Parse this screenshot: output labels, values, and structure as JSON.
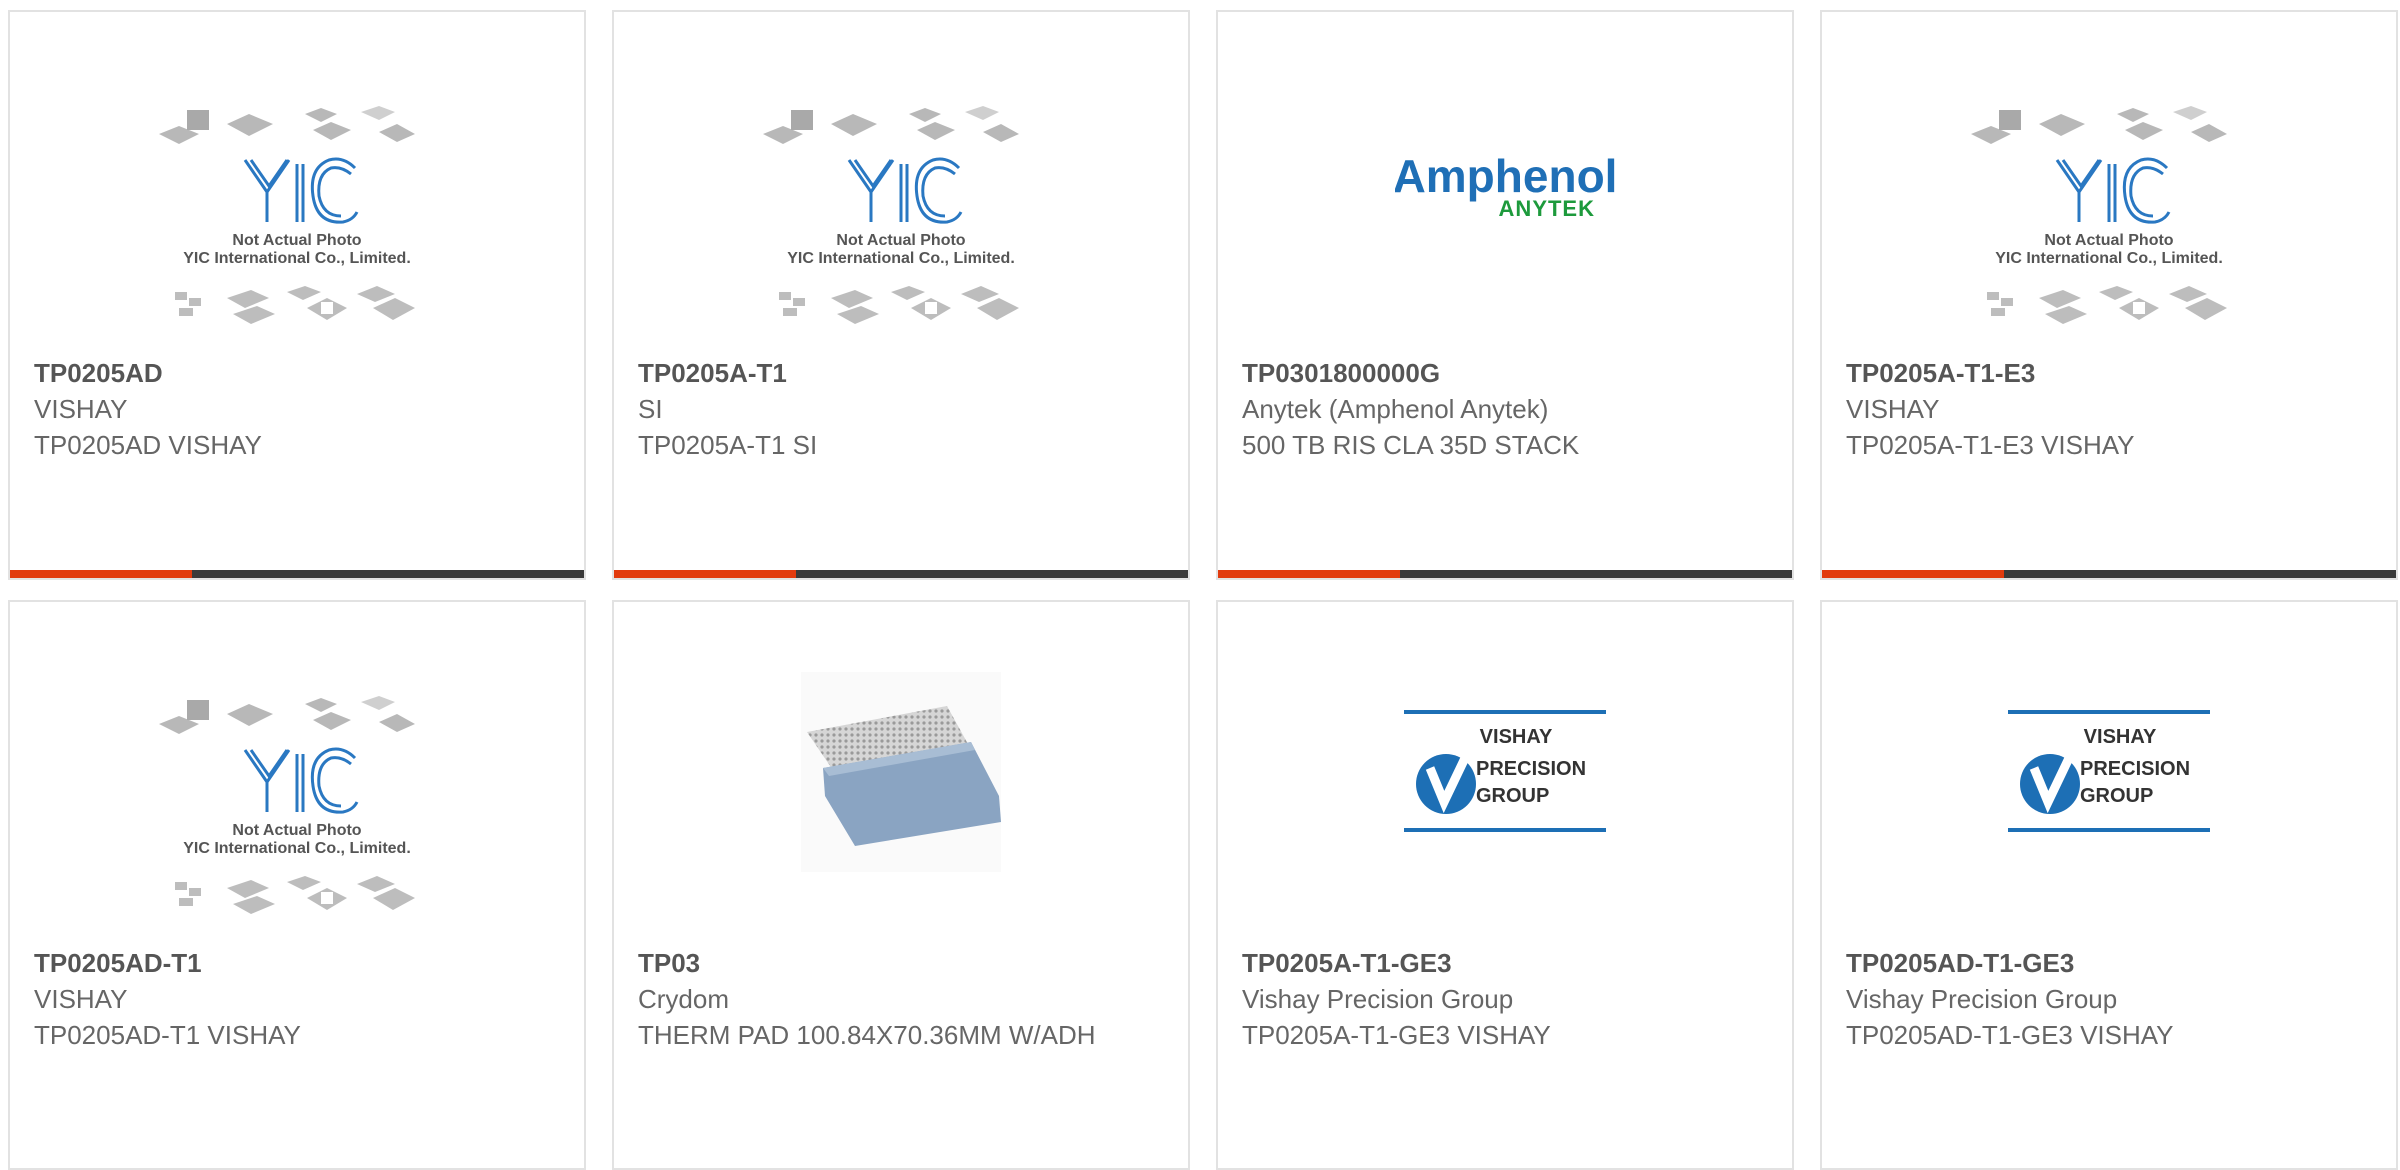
{
  "brand_text": {
    "yic_logo": "YIC",
    "yic_line1": "Not Actual Photo",
    "yic_line2": "YIC International Co., Limited.",
    "amphenol_line1": "Amphenol",
    "amphenol_line2": "ANYTEK",
    "vpg_line1": "VISHAY",
    "vpg_line2": "PRECISION",
    "vpg_line3": "GROUP"
  },
  "colors": {
    "accent": "#e23b0e",
    "bar": "#3a3a3a",
    "card_border": "#e2e2e2",
    "yic_blue": "#2a78c2",
    "amphenol_blue": "#1f6fb6",
    "anytek_green": "#1d9a3c",
    "vpg_blue": "#1d6fb5"
  },
  "products": [
    {
      "part": "TP0205AD",
      "manufacturer": "VISHAY",
      "description": "TP0205AD VISHAY",
      "image": "yic-placeholder-image"
    },
    {
      "part": "TP0205A-T1",
      "manufacturer": "SI",
      "description": "TP0205A-T1 SI",
      "image": "yic-placeholder-image"
    },
    {
      "part": "TP0301800000G",
      "manufacturer": "Anytek (Amphenol Anytek)",
      "description": "500 TB RIS CLA 35D STACK",
      "image": "amphenol-anytek-logo"
    },
    {
      "part": "TP0205A-T1-E3",
      "manufacturer": "VISHAY",
      "description": "TP0205A-T1-E3 VISHAY",
      "image": "yic-placeholder-image"
    },
    {
      "part": "TP0205AD-T1",
      "manufacturer": "VISHAY",
      "description": "TP0205AD-T1 VISHAY",
      "image": "yic-placeholder-image"
    },
    {
      "part": "TP03",
      "manufacturer": "Crydom",
      "description": "THERM PAD 100.84X70.36MM W/ADH",
      "image": "thermal-pad-photo"
    },
    {
      "part": "TP0205A-T1-GE3",
      "manufacturer": "Vishay Precision Group",
      "description": "TP0205A-T1-GE3 VISHAY",
      "image": "vpg-logo"
    },
    {
      "part": "TP0205AD-T1-GE3",
      "manufacturer": "Vishay Precision Group",
      "description": "TP0205AD-T1-GE3 VISHAY",
      "image": "vpg-logo"
    }
  ]
}
